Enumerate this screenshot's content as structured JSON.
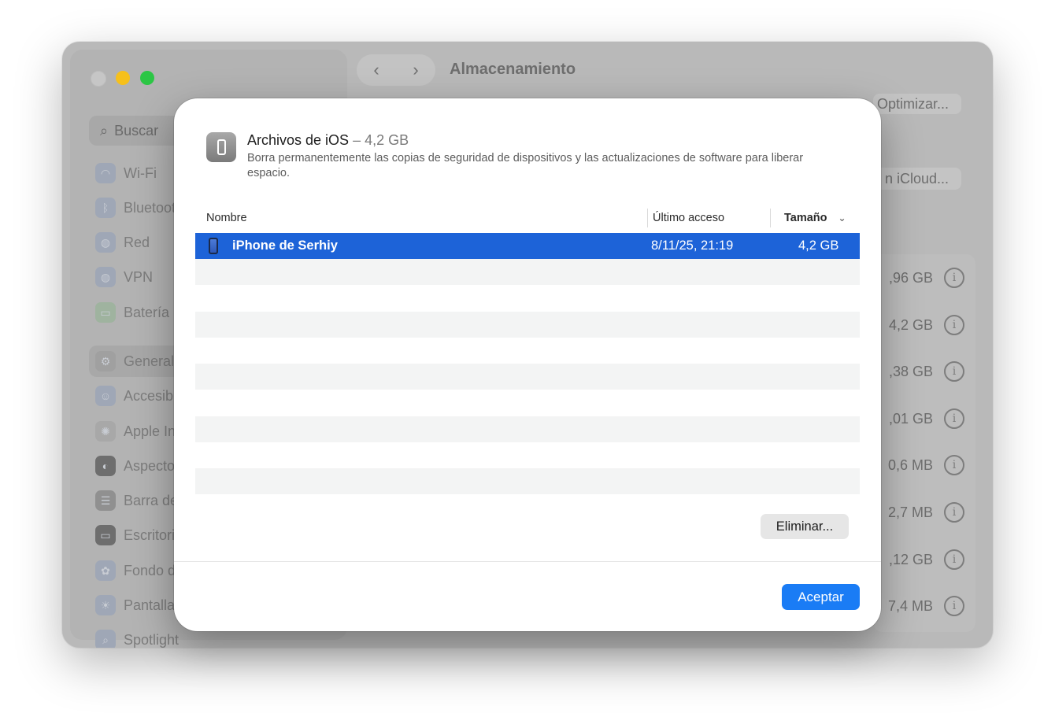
{
  "window": {
    "title": "Almacenamiento",
    "nav_back": "‹",
    "nav_forward": "›",
    "search_placeholder": "Buscar",
    "optimize_button": "Optimizar...",
    "icloud_button": "n iCloud...",
    "sidebar": {
      "items": [
        {
          "label": "Wi-Fi",
          "icon": "wifi-icon"
        },
        {
          "label": "Bluetooth",
          "icon": "bluetooth-icon"
        },
        {
          "label": "Red",
          "icon": "globe-icon"
        },
        {
          "label": "VPN",
          "icon": "vpn-icon"
        },
        {
          "label": "Batería",
          "icon": "battery-icon"
        },
        {
          "label": "General",
          "icon": "gear-icon"
        },
        {
          "label": "Accesibil",
          "icon": "accessibility-icon"
        },
        {
          "label": "Apple Int",
          "icon": "apple-intelligence-icon"
        },
        {
          "label": "Aspecto",
          "icon": "appearance-icon"
        },
        {
          "label": "Barra de",
          "icon": "control-center-icon"
        },
        {
          "label": "Escritorio",
          "icon": "desktop-icon"
        },
        {
          "label": "Fondo de",
          "icon": "wallpaper-icon"
        },
        {
          "label": "Pantallas",
          "icon": "display-icon"
        },
        {
          "label": "Spotlight",
          "icon": "spotlight-icon"
        }
      ]
    },
    "storage_rows": [
      ",96 GB",
      "4,2 GB",
      ",38 GB",
      ",01 GB",
      "0,6 MB",
      "2,7 MB",
      ",12 GB",
      "7,4 MB"
    ]
  },
  "sheet": {
    "title": "Archivos de iOS",
    "title_separator": "–",
    "title_size": "4,2 GB",
    "description": "Borra permanentemente las copias de seguridad de dispositivos y las actualizaciones de software para liberar espacio.",
    "columns": {
      "name": "Nombre",
      "last_access": "Último acceso",
      "size": "Tamaño"
    },
    "rows": [
      {
        "name": "iPhone de Serhiy",
        "last_access": "8/11/25, 21:19",
        "size": "4,2 GB",
        "selected": true
      }
    ],
    "delete_button": "Eliminar...",
    "ok_button": "Aceptar"
  },
  "colors": {
    "accent": "#1a7cf5",
    "selection": "#1d63d8"
  }
}
